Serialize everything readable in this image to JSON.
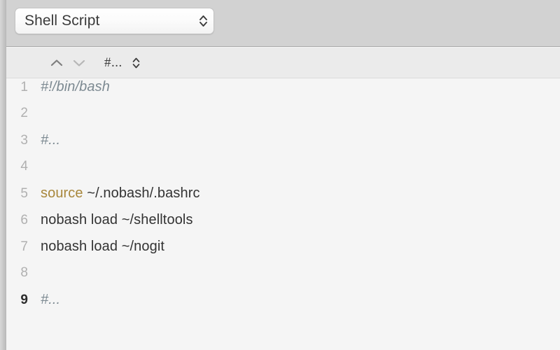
{
  "window": {
    "title": "Shell Script"
  },
  "top_bar": {
    "language_popup": {
      "value": "Shell Script",
      "stepper_icon": "chevron-up-down-icon"
    }
  },
  "sub_toolbar": {
    "prev_label": "",
    "next_label": "",
    "prev_icon": "chevron-up-icon",
    "next_icon": "chevron-down-icon",
    "symbol_label": "#...",
    "symbol_stepper_icon": "chevron-up-down-icon"
  },
  "editor": {
    "active_line": 9,
    "lines": [
      {
        "number": "1",
        "active": false,
        "tokens": [
          {
            "text": "#!/bin/bash",
            "type": "comment"
          }
        ]
      },
      {
        "number": "2",
        "active": false,
        "tokens": []
      },
      {
        "number": "3",
        "active": false,
        "tokens": [
          {
            "text": "#...",
            "type": "comment"
          }
        ]
      },
      {
        "number": "4",
        "active": false,
        "tokens": []
      },
      {
        "number": "5",
        "active": false,
        "tokens": [
          {
            "text": "source",
            "type": "keyword"
          },
          {
            "text": " ~/.nobash/.bashrc",
            "type": "plain"
          }
        ]
      },
      {
        "number": "6",
        "active": false,
        "tokens": [
          {
            "text": "nobash load ~/shelltools",
            "type": "plain"
          }
        ]
      },
      {
        "number": "7",
        "active": false,
        "tokens": [
          {
            "text": "nobash load ~/nogit",
            "type": "plain"
          }
        ]
      },
      {
        "number": "8",
        "active": false,
        "tokens": []
      },
      {
        "number": "9",
        "active": true,
        "tokens": [
          {
            "text": "#...",
            "type": "comment"
          }
        ]
      }
    ]
  },
  "colors": {
    "top_bar_bg": "#d2d2d2",
    "sub_toolbar_bg": "#ebebeb",
    "editor_bg": "#f5f5f5",
    "comment": "#7d8a92",
    "keyword": "#a8873c",
    "plain_text": "#333333",
    "line_number": "#b0b0b0",
    "line_number_active": "#2b2b2b"
  }
}
